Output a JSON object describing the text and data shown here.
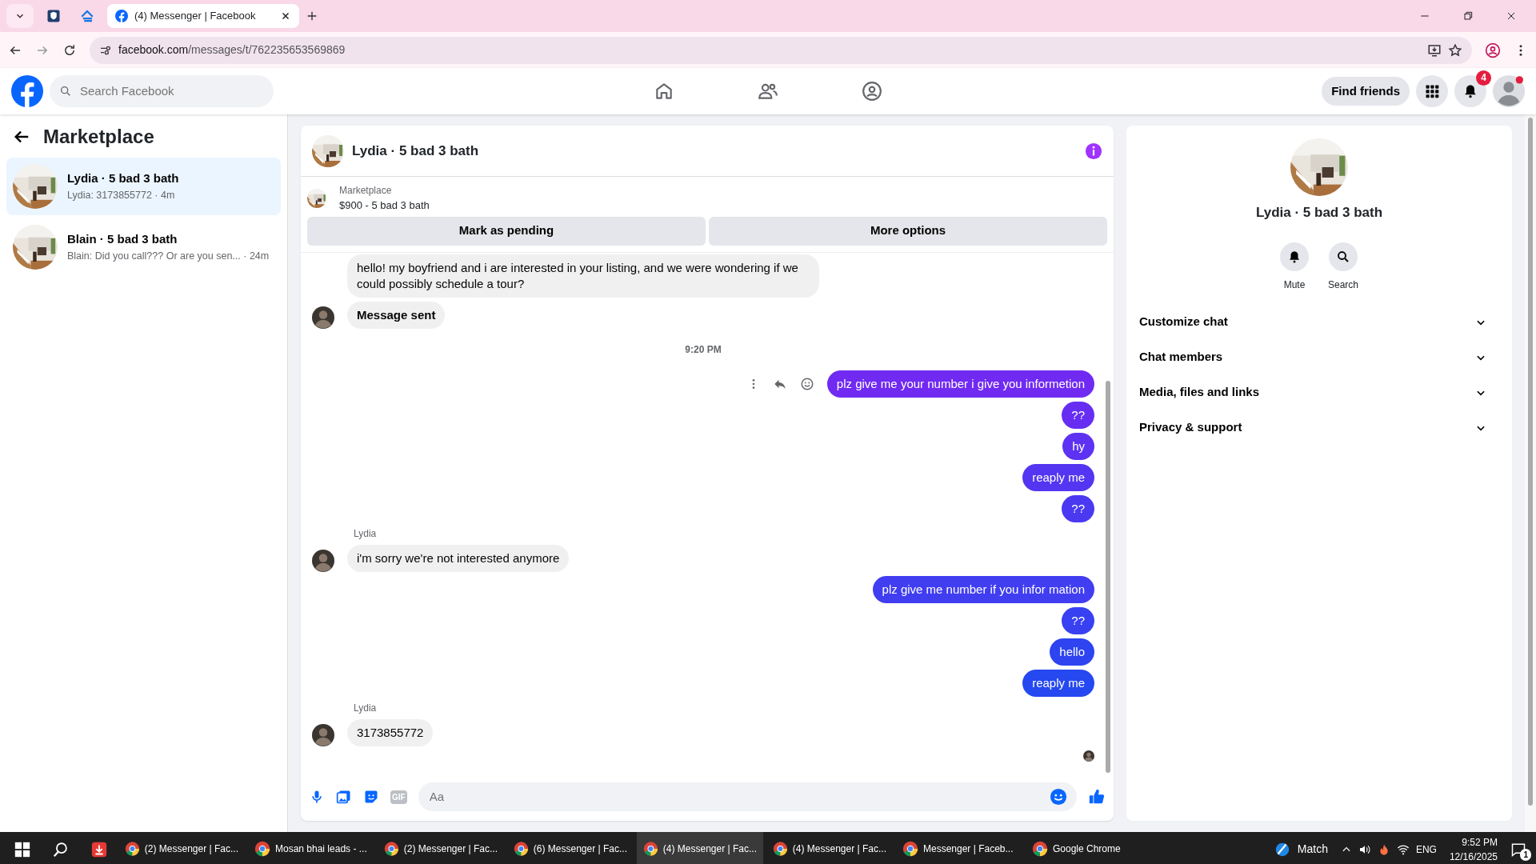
{
  "browser": {
    "tabs": [
      {
        "kind": "pinned",
        "selected": false
      },
      {
        "kind": "pinned",
        "selected": false
      },
      {
        "kind": "page",
        "label": "(4) Messenger | Facebook",
        "selected": true
      }
    ],
    "url_host": "facebook.com",
    "url_path": "/messages/t/762235653569869"
  },
  "topbar": {
    "search_placeholder": "Search Facebook",
    "nav": [
      {
        "kind": "home",
        "selected": false
      },
      {
        "kind": "friends",
        "selected": false
      },
      {
        "kind": "groups",
        "selected": false
      }
    ],
    "find_friends": "Find friends",
    "notification_count": "4"
  },
  "sidebar": {
    "title": "Marketplace",
    "conversations": [
      {
        "title": "Lydia · 5 bad 3 bath",
        "preview": "Lydia: 3173855772 · 4m",
        "selected": true
      },
      {
        "title": "Blain · 5 bad 3 bath",
        "preview": "Blain: Did you call??? Or are you sen... · 24m",
        "selected": false
      }
    ]
  },
  "chat": {
    "title": "Lydia · 5 bad 3 bath",
    "listing_source": "Marketplace",
    "listing": "$900 - 5 bad 3 bath",
    "actions": [
      "Mark as pending",
      "More options"
    ],
    "messages": [
      {
        "kind": "incoming",
        "text": "hello! my boyfriend and i are interested in your listing, and we were wondering if we could possibly schedule a tour?",
        "avatar": false
      },
      {
        "kind": "incoming",
        "text": "Message sent",
        "avatar": true
      },
      {
        "kind": "time",
        "text": "9:20 PM"
      },
      {
        "kind": "outgoing",
        "text": "plz give me your number i give you informetion",
        "actions": true
      },
      {
        "kind": "outgoing",
        "text": "??"
      },
      {
        "kind": "outgoing",
        "text": "hy"
      },
      {
        "kind": "outgoing",
        "text": "reaply me"
      },
      {
        "kind": "outgoing",
        "text": "??"
      },
      {
        "kind": "incoming",
        "sender": "Lydia",
        "text": "i'm sorry we're not interested anymore",
        "avatar": true
      },
      {
        "kind": "outgoing",
        "text": "plz give me number if you infor mation"
      },
      {
        "kind": "outgoing",
        "text": "??"
      },
      {
        "kind": "outgoing",
        "text": "hello"
      },
      {
        "kind": "outgoing",
        "text": "reaply me"
      },
      {
        "kind": "incoming",
        "sender": "Lydia",
        "text": "3173855772",
        "avatar": true
      }
    ],
    "composer": {
      "placeholder": "Aa",
      "gif_label": "GIF"
    }
  },
  "details": {
    "title": "Lydia · 5 bad 3 bath",
    "buttons": [
      {
        "kind": "mute",
        "label": "Mute"
      },
      {
        "kind": "search",
        "label": "Search"
      }
    ],
    "sections": [
      {
        "label": "Customize chat",
        "expanded": false
      },
      {
        "label": "Chat members",
        "expanded": false
      },
      {
        "label": "Media, files and links",
        "expanded": false
      },
      {
        "label": "Privacy & support",
        "expanded": false
      }
    ]
  },
  "taskbar": {
    "apps": [
      {
        "label": "(2) Messenger | Fac...",
        "selected": false
      },
      {
        "label": "Mosan bhai leads - ...",
        "selected": false
      },
      {
        "label": "(2) Messenger | Fac...",
        "selected": false
      },
      {
        "label": "(6) Messenger | Fac...",
        "selected": false
      },
      {
        "label": "(4) Messenger | Fac...",
        "selected": true
      },
      {
        "label": "(4) Messenger | Fac...",
        "selected": false
      },
      {
        "label": "Messenger | Faceb...",
        "selected": false
      },
      {
        "label": "Google Chrome",
        "selected": false
      }
    ],
    "weather": "Match",
    "language": "ENG",
    "time": "9:52 PM",
    "date": "12/16/2025",
    "notifications": "1"
  }
}
